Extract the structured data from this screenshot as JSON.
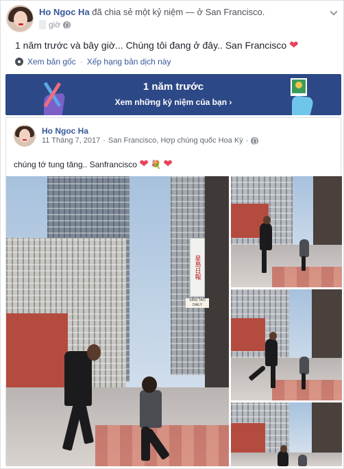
{
  "post": {
    "author": "Ho Ngoc Ha",
    "action_text": "đã chia sẻ một kỷ niệm — ở San Francisco.",
    "time_suffix": "giờ",
    "text": "1 năm trước và bây giờ... Chúng tôi đang ở đây.. San Francisco",
    "text_emoji": "❤",
    "see_original": "Xem bản gốc",
    "separator": "·",
    "rate_translation": "Xếp hạng bản dịch này"
  },
  "memory_banner": {
    "title": "1 năm trước",
    "link": "Xem những kỷ niệm của bạn ›",
    "bg_color": "#2c4886"
  },
  "shared": {
    "author": "Ho Ngoc Ha",
    "date": "11 Tháng 7, 2017",
    "dot": "·",
    "location": "San Francisco, Hợp chúng quốc Hoa Kỳ",
    "dot2": "·",
    "caption": "chúng tớ tung tăng.. Sanfrancisco",
    "caption_emoji1": "❤",
    "caption_emoji2": "💐",
    "caption_emoji3": "❤"
  },
  "photo_signs": {
    "sign1": "星島日報",
    "sign2": "SING TAO DAILY"
  },
  "colors": {
    "link": "#365899",
    "heart": "#e8415c"
  }
}
